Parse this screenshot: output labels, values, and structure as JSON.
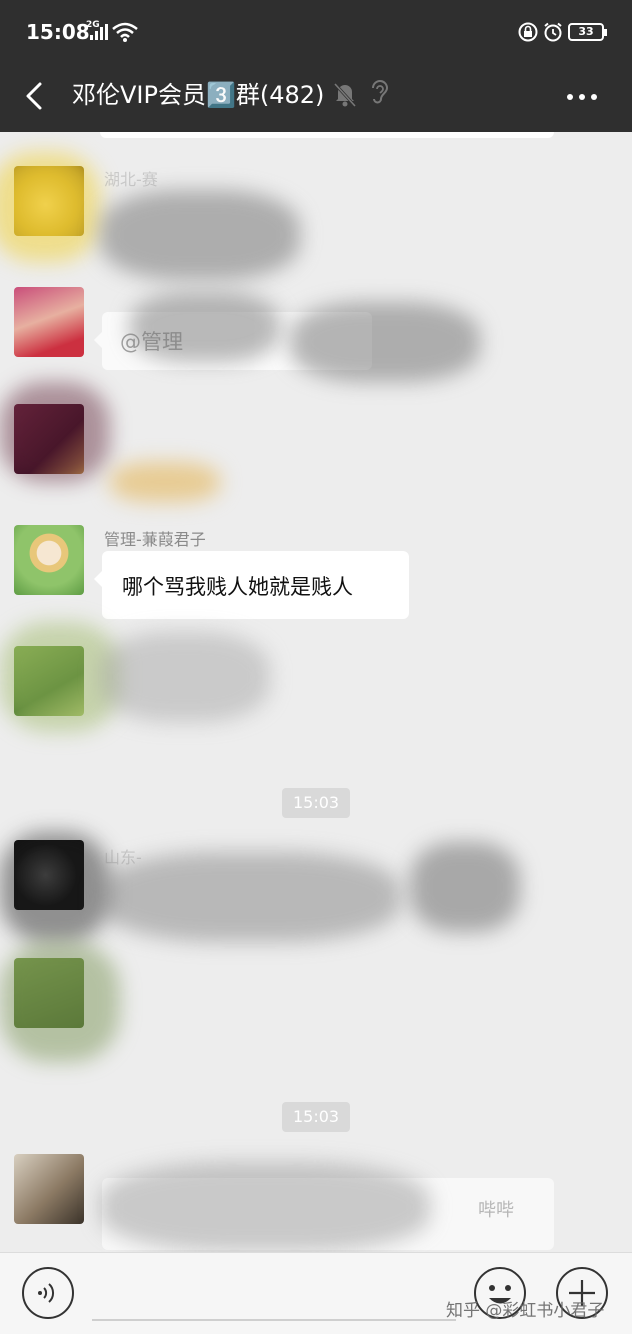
{
  "status_bar": {
    "time": "15:08",
    "network": "2G",
    "battery": "33"
  },
  "header": {
    "title": "邓伦VIP会员3️⃣群(482)",
    "icons": [
      "back-arrow-icon",
      "mute-bell-icon",
      "ear-icon",
      "more-icon"
    ]
  },
  "messages": [
    {
      "sender": "湖北-赛",
      "text": ""
    },
    {
      "sender": "",
      "text": "@管理"
    },
    {
      "sender": "",
      "text": ""
    },
    {
      "sender": "管理-蒹葭君子",
      "text": "哪个骂我贱人她就是贱人"
    },
    {
      "sender": "",
      "text": ""
    }
  ],
  "timestamps": [
    "15:03",
    "15:03"
  ],
  "later_messages": [
    {
      "sender": "山东-",
      "text": ""
    },
    {
      "sender": "",
      "text": ""
    },
    {
      "sender": "",
      "text": "哔哔"
    }
  ],
  "input_bar": {
    "icons": [
      "voice-icon",
      "emoji-icon",
      "plus-icon"
    ]
  },
  "watermark": "知乎 @彩虹书小君子",
  "colors": {
    "header_bg": "#2f2f2f",
    "chat_bg": "#ededed",
    "bubble_bg": "#ffffff",
    "time_chip_bg": "#d9d9d9"
  }
}
